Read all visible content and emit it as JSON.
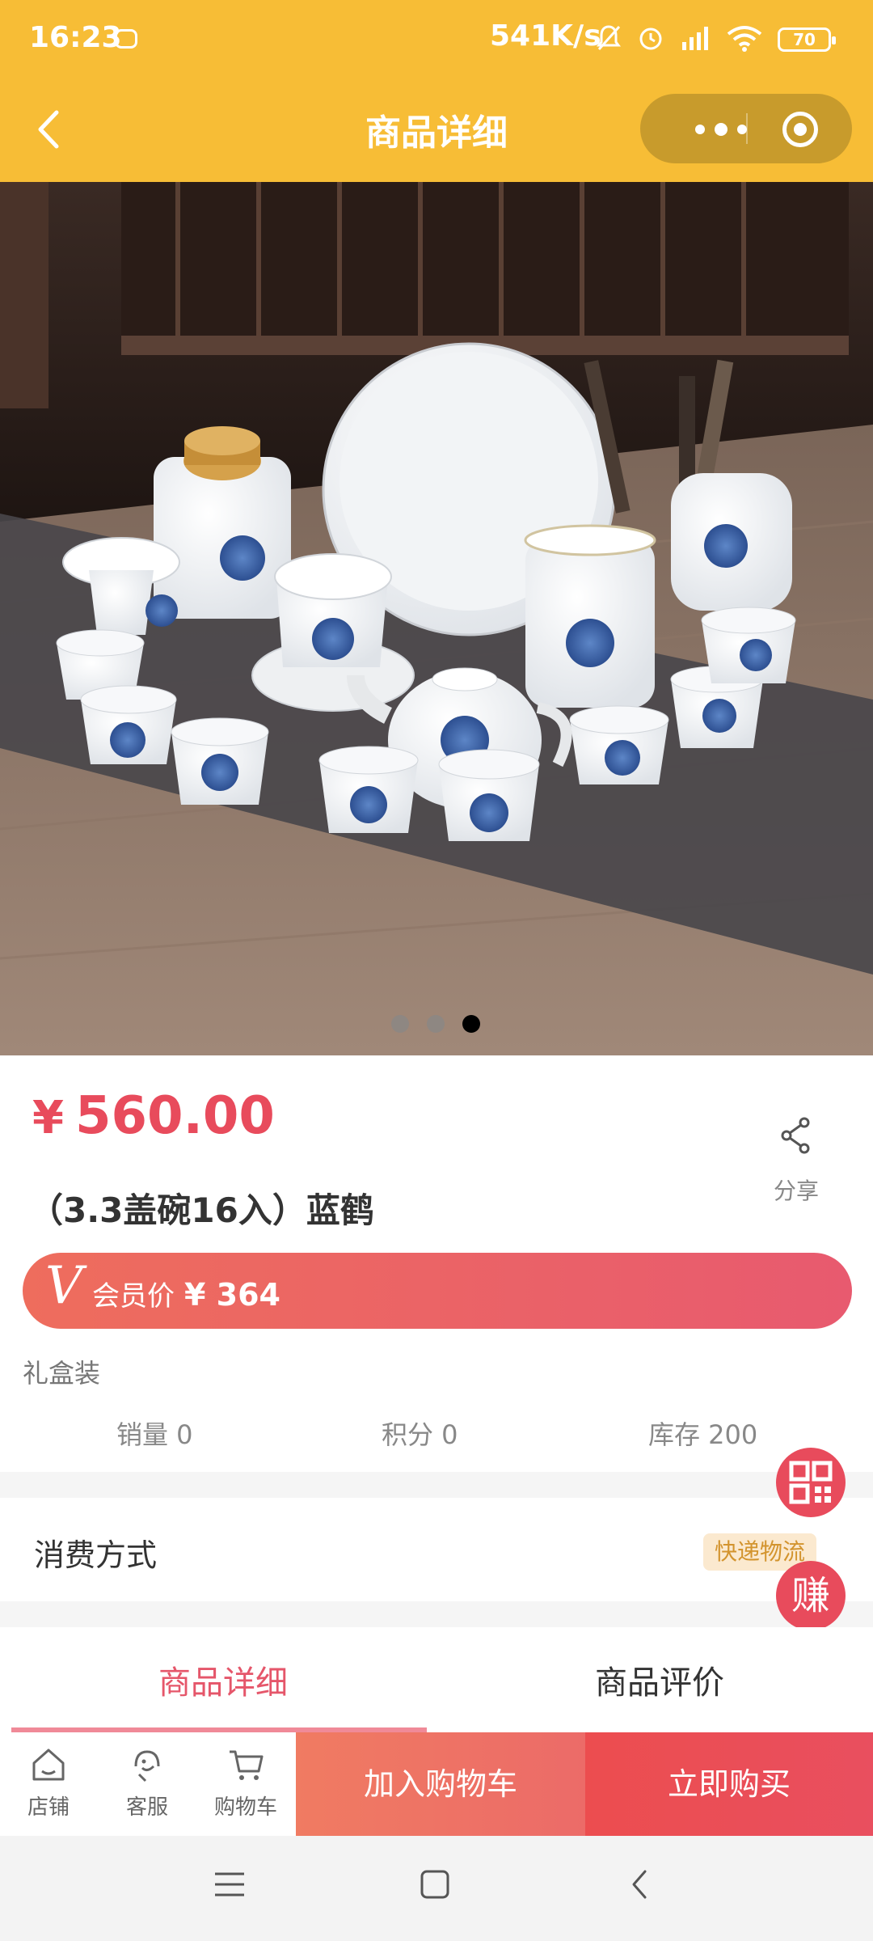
{
  "status_bar": {
    "time": "16:23",
    "net_speed": "541K/s",
    "battery": "70"
  },
  "nav": {
    "title": "商品详细"
  },
  "gallery": {
    "image_desc_icon": "tea-set-photo",
    "dot_count": 3,
    "active_index": 2
  },
  "product": {
    "currency": "¥",
    "price": "560.00",
    "title": "（3.3盖碗16入）蓝鹤",
    "share_label": "分享",
    "vip_badge": "V",
    "vip_label": "会员价",
    "vip_price": "¥ 364",
    "package": "礼盒装",
    "stats": {
      "sales": "销量 0",
      "points": "积分 0",
      "stock": "库存 200"
    }
  },
  "delivery": {
    "label": "消费方式",
    "tag": "快递物流"
  },
  "floating": {
    "earn": "赚"
  },
  "tabs": [
    {
      "label": "商品详细",
      "active": true
    },
    {
      "label": "商品评价",
      "active": false
    }
  ],
  "actionbar": {
    "shop": "店铺",
    "service": "客服",
    "cart": "购物车",
    "add_to_cart": "加入购物车",
    "buy_now": "立即购买"
  },
  "colors": {
    "brand_yellow": "#f7bd36",
    "accent_red": "#e84b5c",
    "tag_bg": "#fbe9cf"
  }
}
